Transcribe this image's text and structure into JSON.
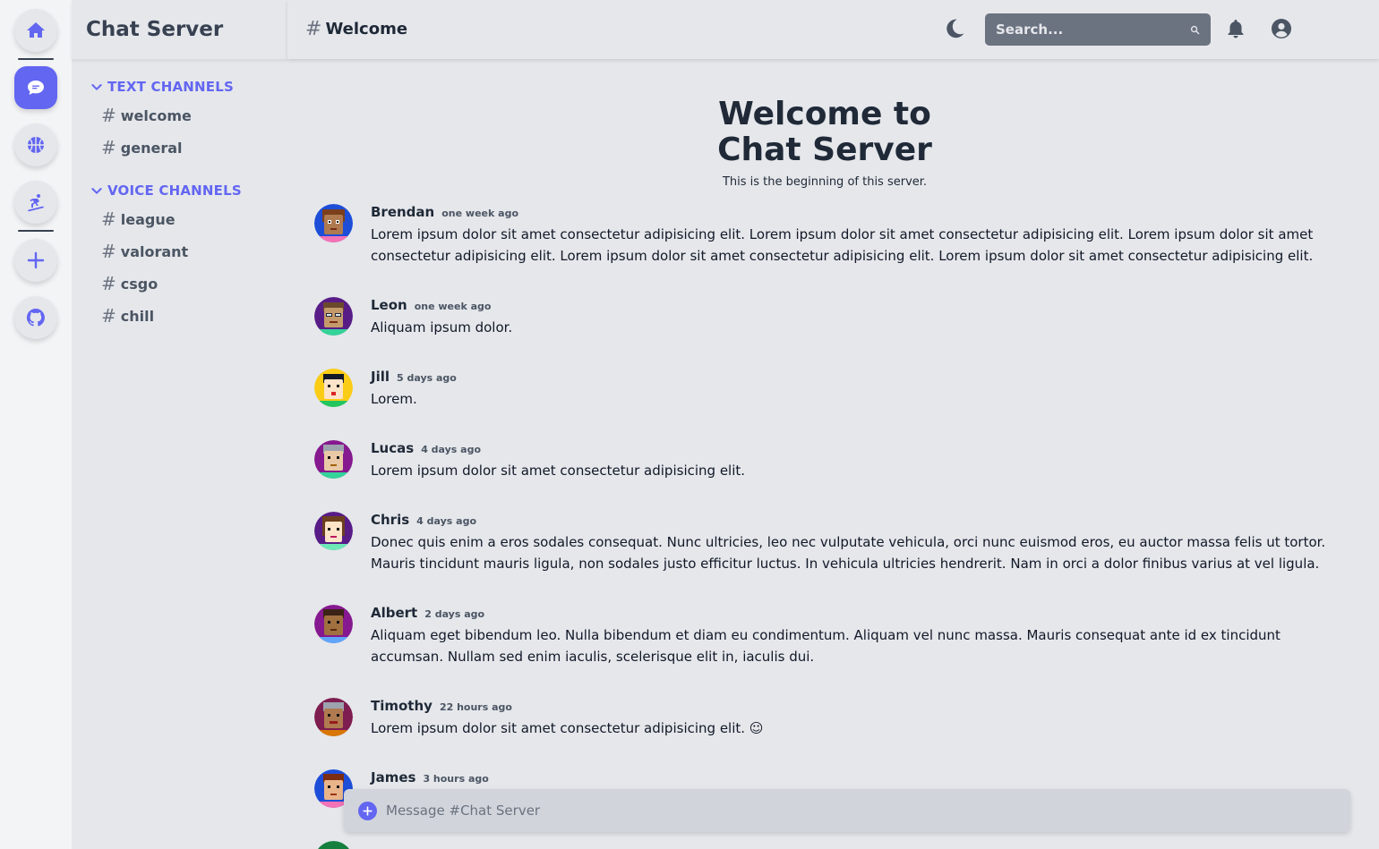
{
  "rail": {
    "items": [
      {
        "icon": "home-icon",
        "active": false
      },
      {
        "icon": "chat-icon",
        "active": true
      },
      {
        "icon": "basketball-icon",
        "active": false
      },
      {
        "icon": "snowboard-icon",
        "active": false
      },
      {
        "icon": "plus-icon",
        "active": false
      },
      {
        "icon": "github-icon",
        "active": false
      }
    ]
  },
  "sidebar": {
    "title": "Chat Server",
    "text_category": "TEXT CHANNELS",
    "text_channels": [
      "welcome",
      "general"
    ],
    "voice_category": "VOICE CHANNELS",
    "voice_channels": [
      "league",
      "valorant",
      "csgo",
      "chill"
    ]
  },
  "topbar": {
    "channel": "Welcome",
    "search_placeholder": "Search..."
  },
  "welcome": {
    "title_line1": "Welcome to",
    "title_line2": "Chat Server",
    "subtitle": "This is the beginning of this server."
  },
  "messages": [
    {
      "name": "Brendan",
      "time": "one week ago",
      "text": "Lorem ipsum dolor sit amet consectetur adipisicing elit. Lorem ipsum dolor sit amet consectetur adipisicing elit. Lorem ipsum dolor sit amet consectetur adipisicing elit. Lorem ipsum dolor sit amet consectetur adipisicing elit. Lorem ipsum dolor sit amet consectetur adipisicing elit."
    },
    {
      "name": "Leon",
      "time": "one week ago",
      "text": "Aliquam ipsum dolor."
    },
    {
      "name": "Jill",
      "time": "5 days ago",
      "text": "Lorem."
    },
    {
      "name": "Lucas",
      "time": "4 days ago",
      "text": "Lorem ipsum dolor sit amet consectetur adipisicing elit."
    },
    {
      "name": "Chris",
      "time": "4 days ago",
      "text": "Donec quis enim a eros sodales consequat. Nunc ultricies, leo nec vulputate vehicula, orci nunc euismod eros, eu auctor massa felis ut tortor. Mauris tincidunt mauris ligula, non sodales justo efficitur luctus. In vehicula ultricies hendrerit. Nam in orci a dolor finibus varius at vel ligula."
    },
    {
      "name": "Albert",
      "time": "2 days ago",
      "text": "Aliquam eget bibendum leo. Nulla bibendum et diam eu condimentum. Aliquam vel nunc massa. Mauris consequat ante id ex tincidunt accumsan. Nullam sed enim iaculis, scelerisque elit in, iaculis dui."
    },
    {
      "name": "Timothy",
      "time": "22 hours ago",
      "text": "Lorem ipsum dolor sit amet consectetur adipisicing elit. ☺"
    },
    {
      "name": "James",
      "time": "3 hours ago",
      "text": ""
    }
  ],
  "composer": {
    "placeholder": "Message #Chat Server"
  },
  "colors": {
    "accent": "#6366f1",
    "background": "#e5e7eb",
    "rail": "#f3f4f6"
  }
}
